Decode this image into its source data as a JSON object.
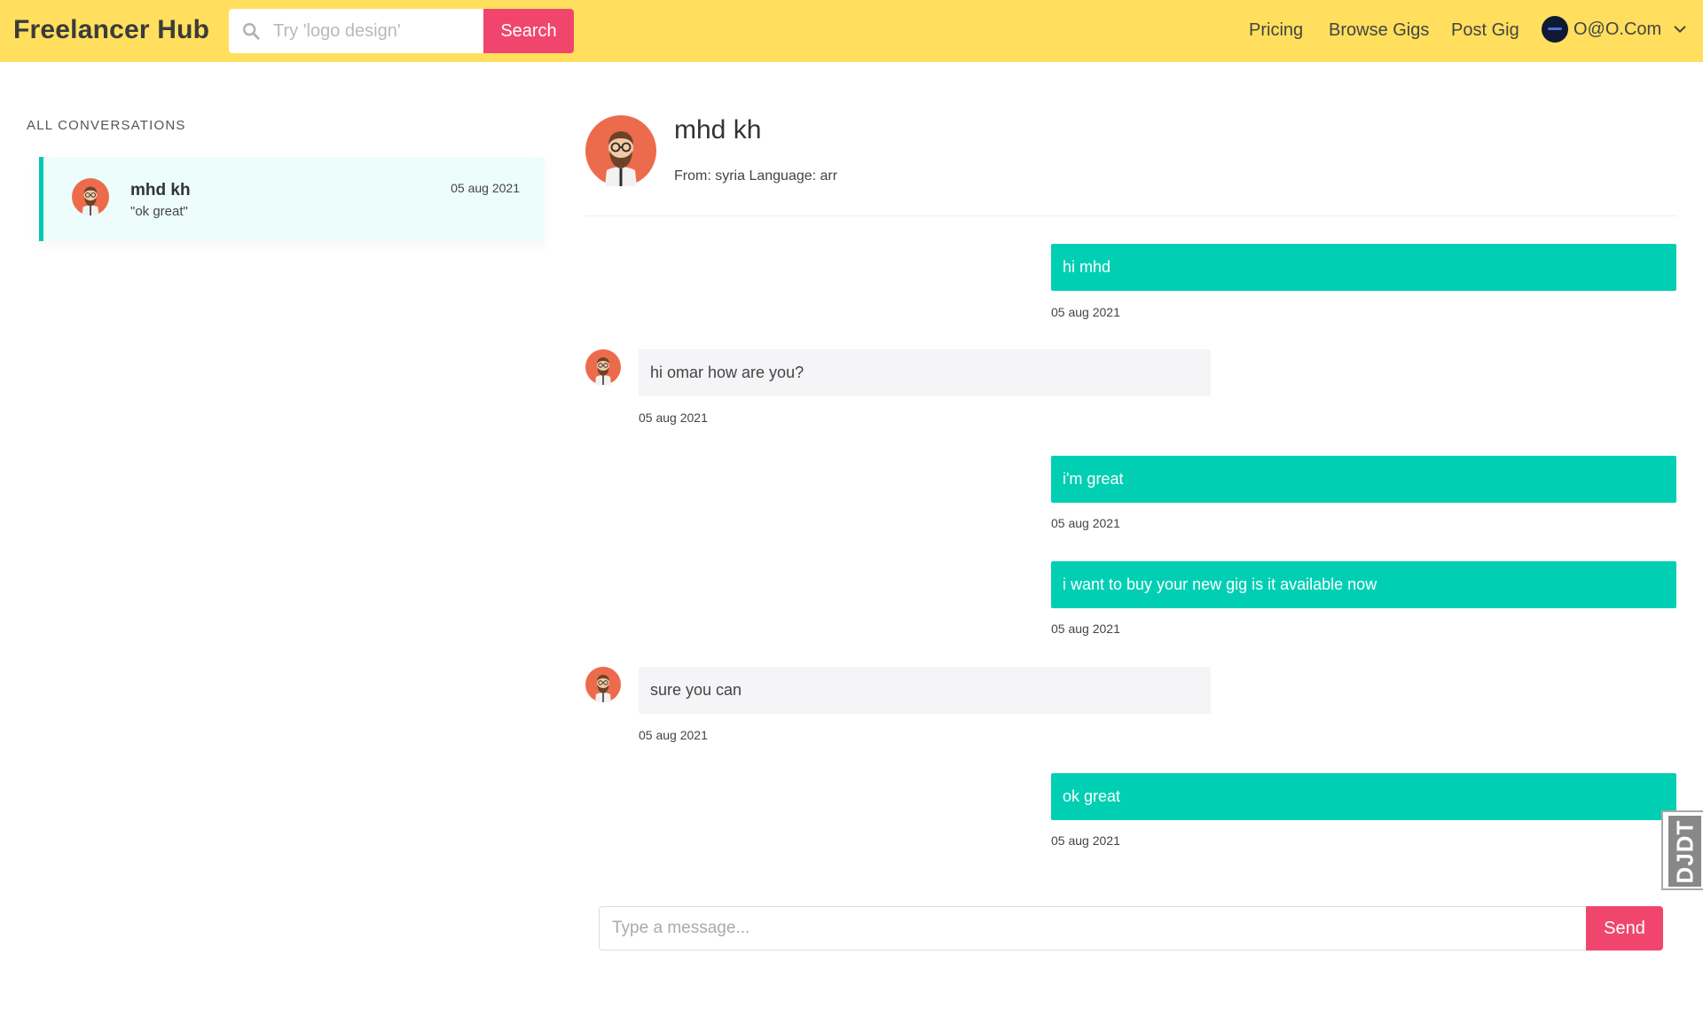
{
  "header": {
    "brand": "Freelancer Hub",
    "search_placeholder": "Try 'logo design'",
    "search_button": "Search",
    "nav_links": [
      "Pricing",
      "Browse Gigs",
      "Post Gig"
    ],
    "user_name": "O@O.Com"
  },
  "sidebar": {
    "heading": "ALL CONVERSATIONS",
    "conversations": [
      {
        "name": "mhd kh",
        "preview": "\"ok great\"",
        "date": "05 aug 2021"
      }
    ]
  },
  "chat": {
    "name": "mhd kh",
    "meta": "From: syria Language: arr",
    "messages": [
      {
        "direction": "out",
        "text": "hi mhd",
        "date": "05 aug 2021"
      },
      {
        "direction": "in",
        "text": "hi omar how are you?",
        "date": "05 aug 2021"
      },
      {
        "direction": "out",
        "text": "i'm great",
        "date": "05 aug 2021"
      },
      {
        "direction": "out",
        "text": "i want to buy your new gig is it available now",
        "date": "05 aug 2021"
      },
      {
        "direction": "in",
        "text": "sure you can",
        "date": "05 aug 2021"
      },
      {
        "direction": "out",
        "text": "ok great",
        "date": "05 aug 2021"
      }
    ]
  },
  "composer": {
    "placeholder": "Type a message...",
    "send_button": "Send"
  },
  "debug_toolbar": {
    "label": "DJDT"
  },
  "colors": {
    "navbar": "#ffdf5d",
    "accent": "#f0466e",
    "outgoing": "#00cfb3",
    "incoming": "#f5f4f7",
    "active_conversation": "#ecfdfb"
  },
  "icons": {
    "search": "search-icon",
    "chevron": "chevron-down-icon",
    "avatar": "avatar-icon"
  }
}
